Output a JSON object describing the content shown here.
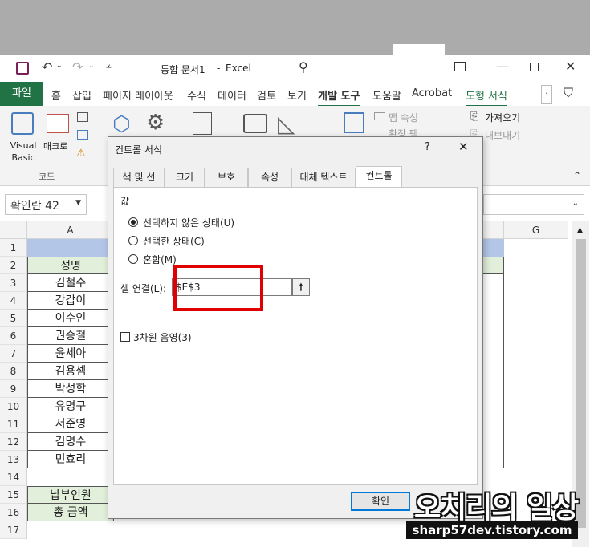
{
  "app": {
    "doc_title": "통합 문서1",
    "app_name": "Excel",
    "separator": "-"
  },
  "ribbon_tabs": [
    "파일",
    "홈",
    "삽입",
    "페이지 레이아웃",
    "수식",
    "데이터",
    "검토",
    "보기",
    "개발 도구",
    "도움말",
    "Acrobat",
    "도형 서식"
  ],
  "ribbon": {
    "visual_basic": "Visual Basic",
    "macro": "매크로",
    "group_code": "코드",
    "map_props": "맵 속성",
    "extension_pack": "확장 팩",
    "import": "가져오기",
    "export": "내보내기"
  },
  "name_box": "확인란 42",
  "columns": [
    "A",
    "G"
  ],
  "rows": [
    "1",
    "2",
    "3",
    "4",
    "5",
    "6",
    "7",
    "8",
    "9",
    "10",
    "11",
    "12",
    "13",
    "14",
    "15",
    "16",
    "17"
  ],
  "column_a": [
    "",
    "성명",
    "김철수",
    "강갑이",
    "이수인",
    "권승철",
    "윤세아",
    "김용셈",
    "박성학",
    "유명구",
    "서준영",
    "김명수",
    "민효리",
    "",
    "납부인원",
    "총 금액",
    ""
  ],
  "dialog": {
    "title": "컨트롤 서식",
    "help": "?",
    "close": "✕",
    "tabs": [
      "색 및 선",
      "크기",
      "보호",
      "속성",
      "대체 텍스트",
      "컨트롤"
    ],
    "group_label": "값",
    "radio_unchecked": "선택하지 않은 상태(U)",
    "radio_checked": "선택한 상태(C)",
    "radio_mixed": "혼합(M)",
    "cell_link_label": "셀 연결(L):",
    "cell_link_value": "$E$3",
    "shading_3d": "3차원 음영(3)",
    "ok": "확인"
  },
  "watermark": {
    "title": "오치리의 일상",
    "url": "sharp57dev.tistory.com"
  },
  "colors": {
    "excel_green": "#217346",
    "highlight_red": "#e00000",
    "header_fill": "#e2efda",
    "blue_row": "#b4c6e7"
  }
}
